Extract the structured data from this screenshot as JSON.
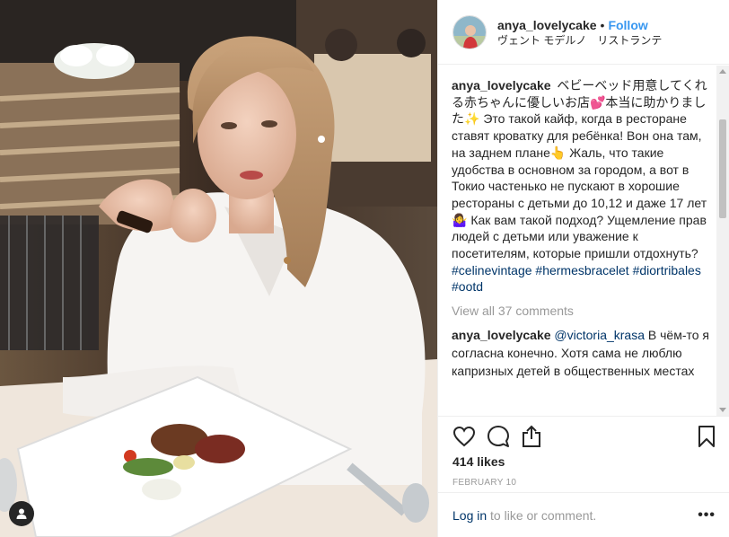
{
  "post": {
    "username": "anya_lovelycake",
    "follow_label": "Follow",
    "location": "ヴェント モデルノ　リストランテ"
  },
  "caption": {
    "username": "anya_lovelycake",
    "text": "ベビーベッド用意してくれる赤ちゃんに優しいお店💕本当に助かりました✨ Это такой кайф, когда в ресторане ставят кроватку для ребёнка! Вон она там, на заднем плане👆 Жаль, что такие удобства в основном за городом, а вот в Токио частенько не пускают в хорошие рестораны с детьми до 10,12 и даже 17 лет🤷‍♀️ Как вам такой подход? Ущемление прав людей с детьми или уважение к посетителям, которые пришли отдохнуть?",
    "hashtags": [
      "#celinevintage",
      "#hermesbracelet",
      "#diortribales",
      "#ootd"
    ]
  },
  "view_all_comments": "View all 37 comments",
  "comments": [
    {
      "username": "anya_lovelycake",
      "mention": "@victoria_krasa",
      "text": "В чём-то я согласна конечно. Хотя сама не люблю капризных детей в общественных местах"
    }
  ],
  "actions": {
    "icons": [
      "heart-icon",
      "comment-icon",
      "share-icon",
      "bookmark-icon"
    ]
  },
  "likes": "414 likes",
  "date": "FEBRUARY 10",
  "add_comment": {
    "login_label": "Log in",
    "rest": " to like or comment.",
    "more": "•••"
  },
  "colors": {
    "link_blue": "#3897f0",
    "hashtag": "#003569",
    "muted": "#999999",
    "border": "#efefef"
  }
}
